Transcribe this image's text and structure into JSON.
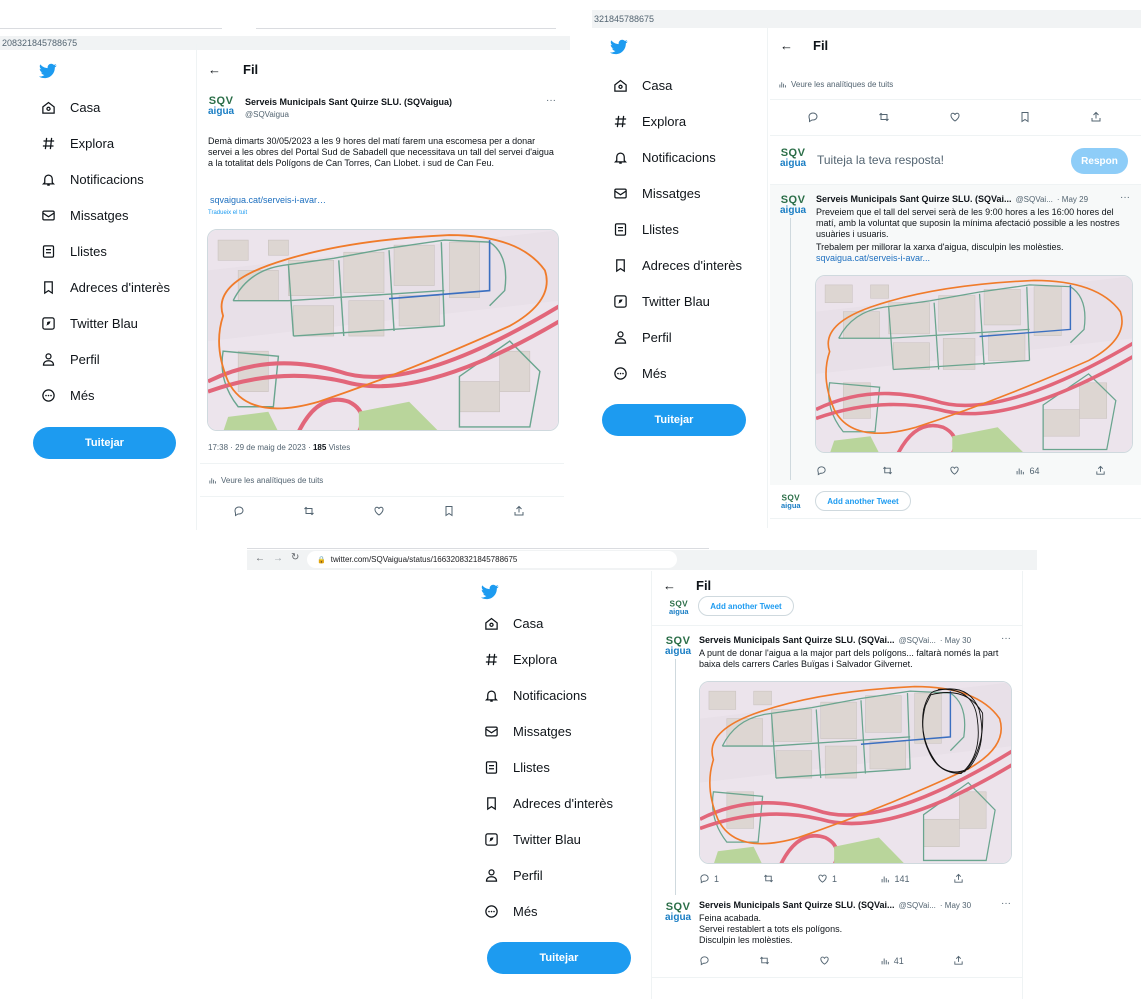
{
  "panel1": {
    "url_fragment": "208321845788675",
    "nav": [
      "Casa",
      "Explora",
      "Notificacions",
      "Missatges",
      "Llistes",
      "Adreces d'interès",
      "Twitter Blau",
      "Perfil",
      "Més"
    ],
    "tweet_button": "Tuitejar",
    "header_title": "Fil",
    "tweet": {
      "name": "Serveis Municipals Sant Quirze SLU. (SQVaigua)",
      "handle": "@SQVaigua",
      "more": "···",
      "text": "Demà dimarts 30/05/2023 a les 9 hores del matí farem una escomesa per a donar servei a les obres del Portal Sud de Sabadell que necessitava un tall del servei d'aigua a la totalitat dels Polígons de Can Torres, Can Llobet. i sud de Can Feu.",
      "link": "sqvaigua.cat/serveis-i-avar…",
      "translate": "Tradueix el tuit",
      "timestamp": "17:38 · 29 de maig de 2023 · ",
      "views_count": "185",
      "views_label": "Vistes",
      "analytics": "Veure les analítiques de tuits"
    }
  },
  "panel2": {
    "url_fragment": "321845788675",
    "nav": [
      "Casa",
      "Explora",
      "Notificacions",
      "Missatges",
      "Llistes",
      "Adreces d'interès",
      "Twitter Blau",
      "Perfil",
      "Més"
    ],
    "tweet_button": "Tuitejar",
    "header_title": "Fil",
    "analytics": "Veure les analítiques de tuits",
    "reply_placeholder": "Tuiteja la teva resposta!",
    "reply_button": "Respon",
    "tweet": {
      "name": "Serveis Municipals Sant Quirze SLU. (SQVai...",
      "handle": "@SQVai...",
      "date": "· May 29",
      "more": "···",
      "text": "Preveiem que el tall del servei serà de les 9:00 hores a les 16:00 hores del matí, amb la voluntat que suposin la mínima afectació possible a les nostres usuàries i usuaris.",
      "text2": "Trebalem per millorar la xarxa d'aigua, disculpin les molèsties.",
      "link": "sqvaigua.cat/serveis-i-avar...",
      "views": "64"
    },
    "add_another": "Add another Tweet"
  },
  "panel3": {
    "url": "twitter.com/SQVaigua/status/1663208321845788675",
    "nav": [
      "Casa",
      "Explora",
      "Notificacions",
      "Missatges",
      "Llistes",
      "Adreces d'interès",
      "Twitter Blau",
      "Perfil",
      "Més"
    ],
    "tweet_button": "Tuitejar",
    "header_title": "Fil",
    "add_another": "Add another Tweet",
    "tweet1": {
      "name": "Serveis Municipals Sant Quirze SLU. (SQVai...",
      "handle": "@SQVai...",
      "date": "· May 30",
      "more": "···",
      "text": "A punt de donar l'aigua a la major part dels polígons... faltarà només la part baixa dels carrers Carles Buïgas i Salvador Gilvernet.",
      "replies": "1",
      "likes": "1",
      "views": "141"
    },
    "tweet2": {
      "name": "Serveis Municipals Sant Quirze SLU. (SQVai...",
      "handle": "@SQVai...",
      "date": "· May 30",
      "more": "···",
      "line1": "Feina acabada.",
      "line2": "Servei restablert a tots els polígons.",
      "line3": "Disculpin les molèsties.",
      "views": "41"
    }
  },
  "brand": {
    "sqv_top": "SQV",
    "sqv_bottom": "aigua",
    "twitter_blue": "#1d9bf0",
    "map_orange": "#f07b2a"
  }
}
